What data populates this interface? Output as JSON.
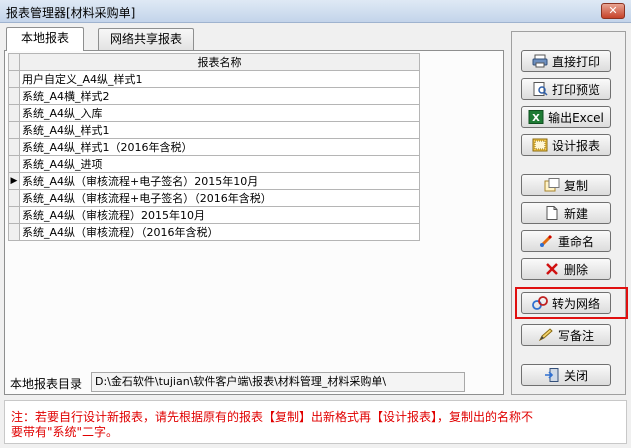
{
  "window": {
    "title": "报表管理器[材料采购单]",
    "close_glyph": "✕"
  },
  "tabs": [
    {
      "label": "本地报表",
      "active": true
    },
    {
      "label": "网络共享报表",
      "active": false
    }
  ],
  "table": {
    "header": "报表名称",
    "selected_index": 6,
    "indicator_glyph": "▶",
    "rows": [
      "用户自定义_A4纵_样式1",
      "系统_A4横_样式2",
      "系统_A4纵_入库",
      "系统_A4纵_样式1",
      "系统_A4纵_样式1（2016年含税）",
      "系统_A4纵_进项",
      "系统_A4纵（审核流程+电子签名）2015年10月",
      "系统_A4纵（审核流程+电子签名）（2016年含税）",
      "系统_A4纵（审核流程）2015年10月",
      "系统_A4纵（审核流程）（2016年含税）"
    ]
  },
  "directory": {
    "label": "本地报表目录",
    "path": "D:\\金石软件\\tujian\\软件客户端\\报表\\材料管理_材料采购单\\"
  },
  "buttons": {
    "direct_print": "直接打印",
    "print_preview": "打印预览",
    "export_excel": "输出Excel",
    "design_report": "设计报表",
    "copy": "复制",
    "new": "新建",
    "rename": "重命名",
    "delete": "删除",
    "to_network": "转为网络",
    "write_note": "写备注",
    "close": "关闭"
  },
  "note": {
    "text": "注：若要自行设计新报表，请先根据原有的报表【复制】出新格式再【设计报表】，复制出的名称不要带有\"系统\"二字。"
  },
  "colors": {
    "note_text": "#e00000",
    "highlight": "#e01010",
    "excel_green": "#1e7b34"
  }
}
